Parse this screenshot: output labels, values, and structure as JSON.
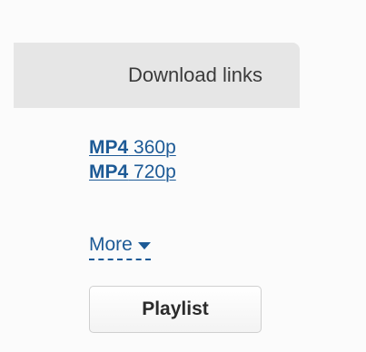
{
  "panel": {
    "title": "Download links"
  },
  "links": [
    {
      "format": "MP4",
      "resolution": "360p"
    },
    {
      "format": "MP4",
      "resolution": "720p"
    }
  ],
  "more": {
    "label": "More",
    "icon": "caret-down-icon"
  },
  "playlist_button": {
    "label": "Playlist"
  },
  "colors": {
    "link": "#1d5a96",
    "header_bg": "#e6e6e6",
    "page_bg": "#fbfbfb"
  }
}
